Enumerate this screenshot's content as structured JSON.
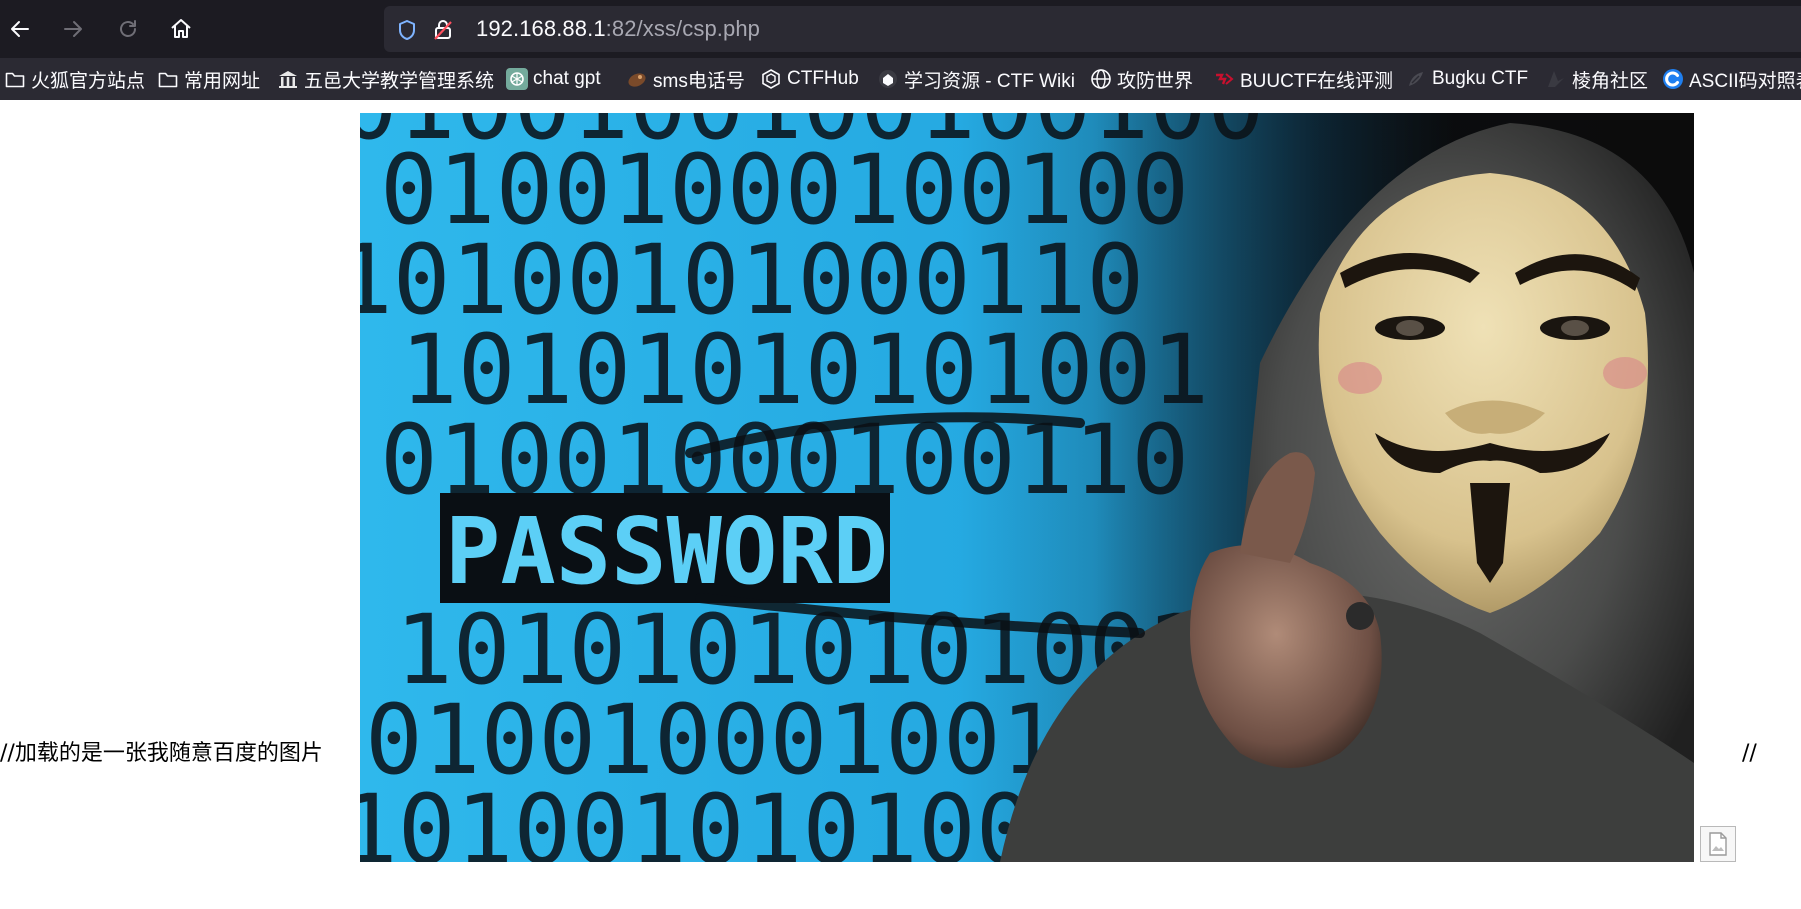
{
  "browser": {
    "url": {
      "host": "192.168.88.1",
      "rest": ":82/xss/csp.php"
    },
    "nav_icons": [
      "back-arrow-icon",
      "forward-arrow-icon",
      "reload-icon",
      "home-icon"
    ],
    "bookmarks": [
      {
        "label": "火狐官方站点",
        "icon": "folder-icon"
      },
      {
        "label": "常用网址",
        "icon": "folder-icon"
      },
      {
        "label": "五邑大学教学管理系统",
        "icon": "university-icon"
      },
      {
        "label": "chat gpt",
        "icon": "openai-icon"
      },
      {
        "label": "sms电话号",
        "icon": "sms-icon"
      },
      {
        "label": "CTFHub",
        "icon": "ctfhub-icon"
      },
      {
        "label": "学习资源 - CTF Wiki",
        "icon": "ctfwiki-icon"
      },
      {
        "label": "攻防世界",
        "icon": "globe-icon"
      },
      {
        "label": "BUUCTF在线评测",
        "icon": "buuctf-icon"
      },
      {
        "label": "Bugku CTF",
        "icon": "bugku-icon"
      },
      {
        "label": "棱角社区",
        "icon": "lengjiao-icon"
      },
      {
        "label": "ASCII码对照表",
        "icon": "ascii-icon"
      }
    ]
  },
  "page": {
    "comment_left": "//加载的是一张我随意百度的图片",
    "comment_right": "//",
    "hero_image": {
      "overlay_word": "PASSWORD",
      "binary_rows": [
        "01001000100100",
        "10100101000110",
        "10101010101001",
        "01001000100110",
        "PASSWORD",
        "10101010101001",
        "01001000100100",
        "10100101010010"
      ]
    },
    "broken_image_icon": "broken-image-icon"
  },
  "colors": {
    "toolbar_bg": "#1c1b22",
    "urlbar_bg": "#2b2a33",
    "bookmark_bg": "#2b2a33",
    "hero_blue": "#2fb4e8"
  }
}
